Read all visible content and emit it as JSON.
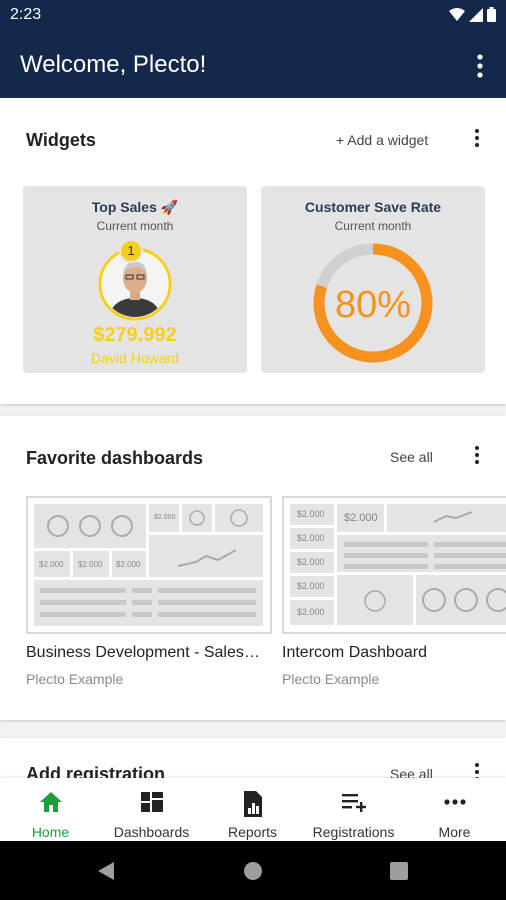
{
  "status_bar": {
    "time": "2:23",
    "icons": [
      "wifi-icon",
      "signal-icon",
      "battery-icon"
    ]
  },
  "app_bar": {
    "title": "Welcome, Plecto!",
    "menu_icon": "more-vert-icon"
  },
  "widgets_section": {
    "title": "Widgets",
    "add_label": "+ Add a widget",
    "widgets": [
      {
        "title": "Top Sales 🚀",
        "subtitle": "Current month",
        "rank": "1",
        "value": "$279.992",
        "name": "David Howard"
      },
      {
        "title": "Customer Save Rate",
        "subtitle": "Current month",
        "value": "80%",
        "progress": 0.8
      }
    ]
  },
  "favorites_section": {
    "title": "Favorite dashboards",
    "see_all_label": "See all",
    "dashboards": [
      {
        "name": "Business Development - Sales…",
        "subtitle": "Plecto Example",
        "thumb_value": "$2.000"
      },
      {
        "name": "Intercom Dashboard",
        "subtitle": "Plecto Example",
        "thumb_value": "$2.000"
      }
    ]
  },
  "registration_section": {
    "title": "Add registration",
    "see_all_label": "See all"
  },
  "bottom_nav": {
    "items": [
      {
        "label": "Home",
        "icon": "home-icon",
        "active": true
      },
      {
        "label": "Dashboards",
        "icon": "dashboards-icon",
        "active": false
      },
      {
        "label": "Reports",
        "icon": "reports-icon",
        "active": false
      },
      {
        "label": "Registrations",
        "icon": "registrations-icon",
        "active": false
      },
      {
        "label": "More",
        "icon": "more-horiz-icon",
        "active": false
      }
    ]
  },
  "colors": {
    "primary": "#13284a",
    "accent_green": "#1e9e3a",
    "gold": "#f5cf1b",
    "orange": "#f7921e"
  }
}
